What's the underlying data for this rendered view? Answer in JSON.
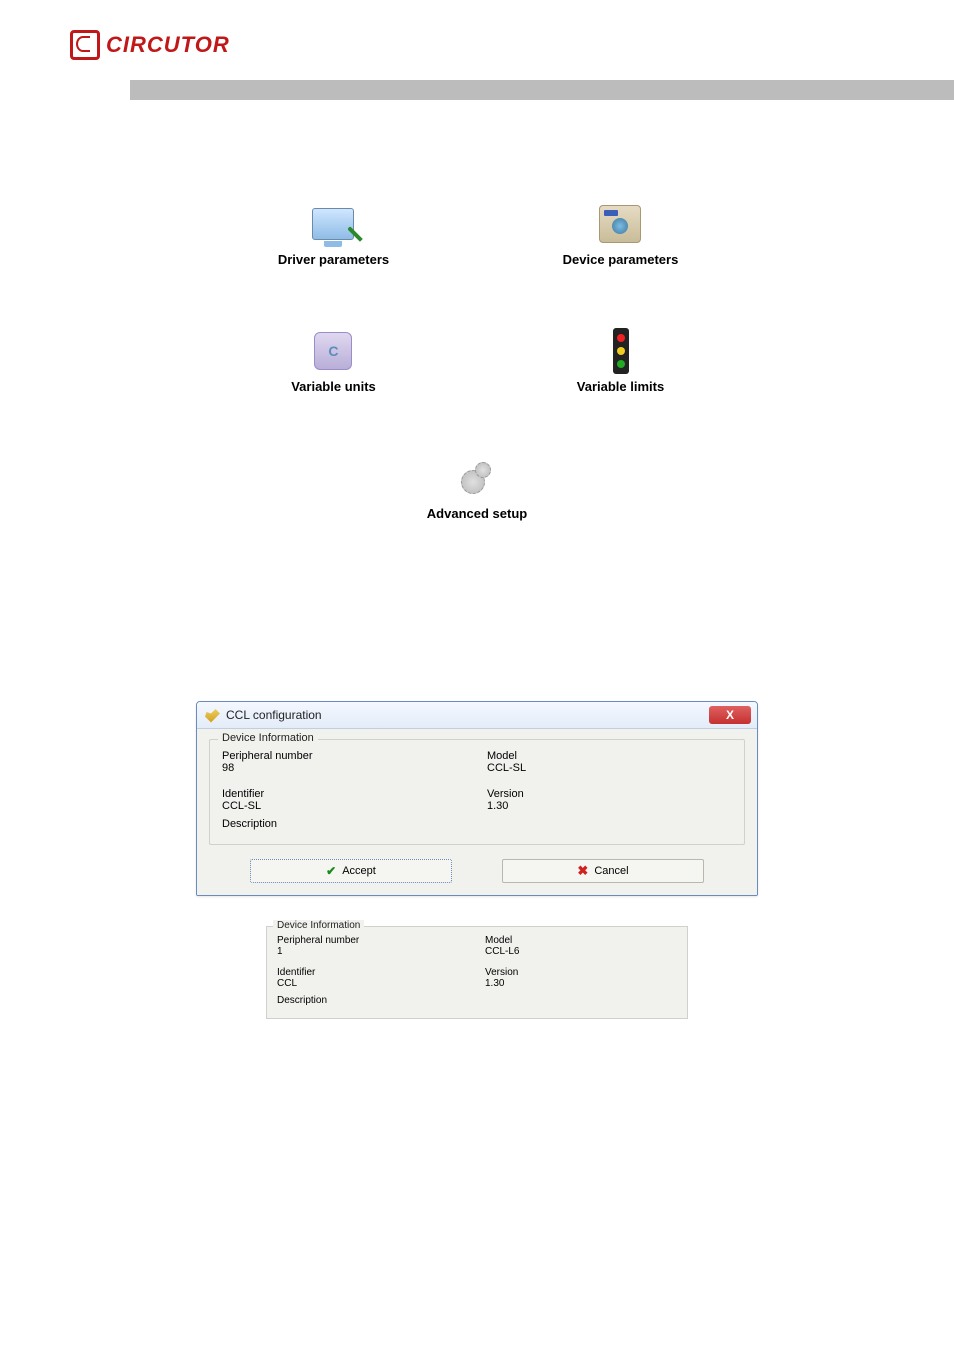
{
  "logo": {
    "text": "CIRCUTOR"
  },
  "icons": {
    "driver_parameters": "Driver parameters",
    "device_parameters": "Device parameters",
    "variable_units": "Variable units",
    "variable_limits": "Variable limits",
    "advanced_setup": "Advanced setup"
  },
  "dialog": {
    "title": "CCL configuration",
    "legend": "Device Information",
    "peripheral_label": "Peripheral number",
    "peripheral_value": "98",
    "model_label": "Model",
    "model_value": "CCL-SL",
    "identifier_label": "Identifier",
    "identifier_value": "CCL-SL",
    "version_label": "Version",
    "version_value": "1.30",
    "description_label": "Description",
    "accept": "Accept",
    "cancel": "Cancel"
  },
  "mini": {
    "legend": "Device Information",
    "peripheral_label": "Peripheral number",
    "peripheral_value": "1",
    "model_label": "Model",
    "model_value": "CCL-L6",
    "identifier_label": "Identifier",
    "identifier_value": "CCL",
    "version_label": "Version",
    "version_value": "1.30",
    "description_label": "Description"
  }
}
